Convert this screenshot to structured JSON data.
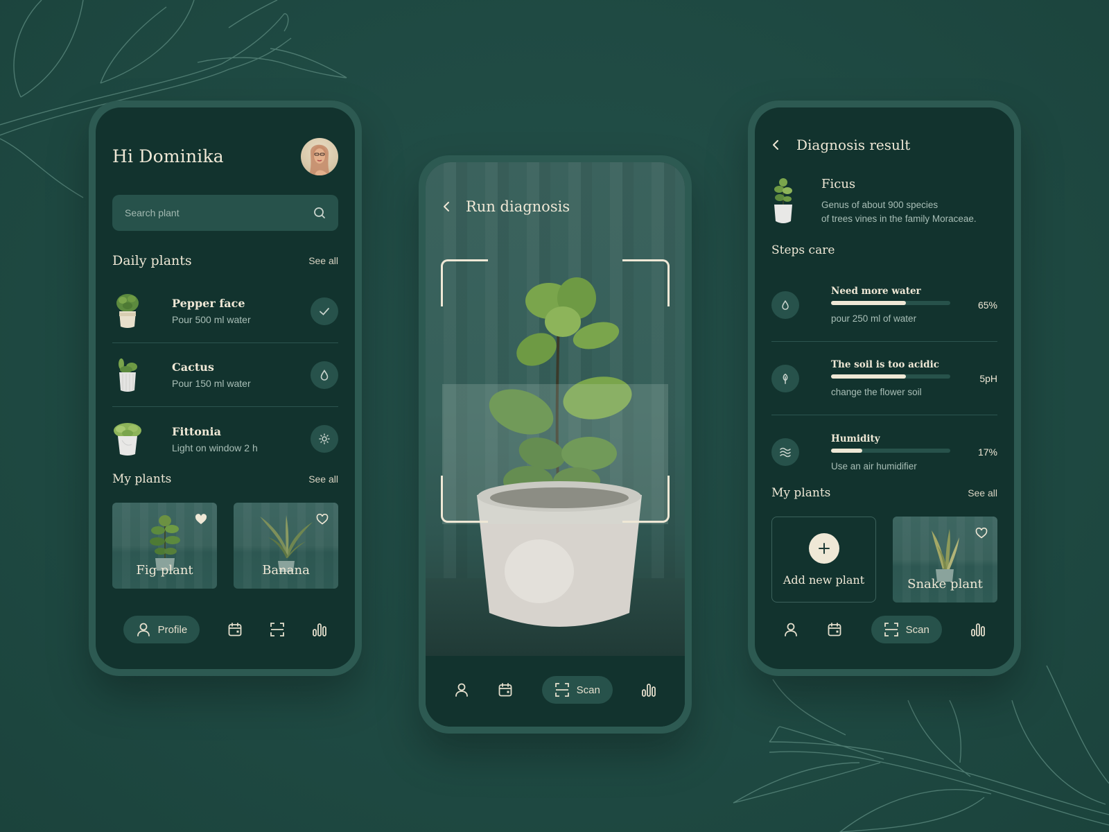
{
  "theme": {
    "background": "#1f4a43",
    "screen": "#12332e",
    "frame": "#2d5a52",
    "surface": "#27524b",
    "accent_cream": "#efe8d6",
    "muted_text": "#a9bfb7"
  },
  "home_screen": {
    "greeting": "Hi Dominika",
    "avatar_icon": "user-avatar-photo",
    "search": {
      "placeholder": "Search plant",
      "value": "",
      "icon": "search-icon"
    },
    "daily_plants": {
      "title": "Daily plants",
      "see_all": "See all",
      "items": [
        {
          "name": "Pepper face",
          "task": "Pour 500 ml water",
          "action_icon": "check-icon"
        },
        {
          "name": "Cactus",
          "task": "Pour 150 ml water",
          "action_icon": "water-drop-icon"
        },
        {
          "name": "Fittonia",
          "task": "Light on window 2 h",
          "action_icon": "sun-icon"
        }
      ]
    },
    "my_plants": {
      "title": "My plants",
      "see_all": "See all",
      "items": [
        {
          "name": "Fig plant",
          "favorite": true
        },
        {
          "name": "Banana",
          "favorite": false
        }
      ]
    },
    "nav": {
      "active": "Profile",
      "items": [
        {
          "icon": "user-icon",
          "label": "Profile"
        },
        {
          "icon": "calendar-icon",
          "label": ""
        },
        {
          "icon": "scan-icon",
          "label": ""
        },
        {
          "icon": "stats-icon",
          "label": ""
        }
      ]
    }
  },
  "scan_screen": {
    "back_icon": "chevron-left-icon",
    "title": "Run diagnosis",
    "nav": {
      "active": "Scan",
      "items": [
        {
          "icon": "user-icon",
          "label": ""
        },
        {
          "icon": "calendar-icon",
          "label": ""
        },
        {
          "icon": "scan-icon",
          "label": "Scan"
        },
        {
          "icon": "stats-icon",
          "label": ""
        }
      ]
    }
  },
  "result_screen": {
    "back_icon": "chevron-left-icon",
    "title": "Diagnosis result",
    "plant": {
      "name": "Ficus",
      "description_line1": "Genus of about 900 species",
      "description_line2": "of trees vines in the family Moraceae."
    },
    "steps_title": "Steps care",
    "steps": [
      {
        "icon": "water-drop-icon",
        "title": "Need more water",
        "hint": "pour 250 ml of water",
        "value": "65%",
        "progress": 0.63
      },
      {
        "icon": "soil-leaf-icon",
        "title": "The soil is too acidic",
        "hint": "change the flower soil",
        "value": "5pH",
        "progress": 0.63
      },
      {
        "icon": "humidity-waves-icon",
        "title": "Humidity",
        "hint": "Use an air humidifier",
        "value": "17%",
        "progress": 0.26
      }
    ],
    "my_plants": {
      "title": "My plants",
      "see_all": "See all",
      "add_label": "Add new plant",
      "items": [
        {
          "name": "Snake plant",
          "favorite": false
        }
      ]
    },
    "nav": {
      "active": "Scan",
      "items": [
        {
          "icon": "user-icon",
          "label": ""
        },
        {
          "icon": "calendar-icon",
          "label": ""
        },
        {
          "icon": "scan-icon",
          "label": "Scan"
        },
        {
          "icon": "stats-icon",
          "label": ""
        }
      ]
    }
  }
}
